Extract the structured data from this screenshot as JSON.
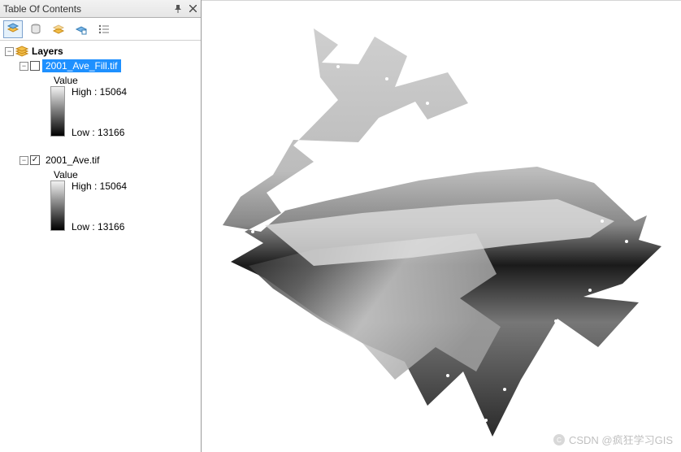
{
  "toc": {
    "title": "Table Of Contents",
    "layers_root_label": "Layers",
    "layers": [
      {
        "name": "2001_Ave_Fill.tif",
        "checked": false,
        "selected": true,
        "value_label": "Value",
        "high_label": "High : 15064",
        "low_label": "Low : 13166"
      },
      {
        "name": "2001_Ave.tif",
        "checked": true,
        "selected": false,
        "value_label": "Value",
        "high_label": "High : 15064",
        "low_label": "Low : 13166"
      }
    ]
  },
  "toolbar": {
    "btn1": "list-by-drawing-order",
    "btn2": "list-by-source",
    "btn3": "list-by-visibility",
    "btn4": "list-by-selection",
    "btn5": "options"
  },
  "watermark": "CSDN @疯狂学习GIS"
}
